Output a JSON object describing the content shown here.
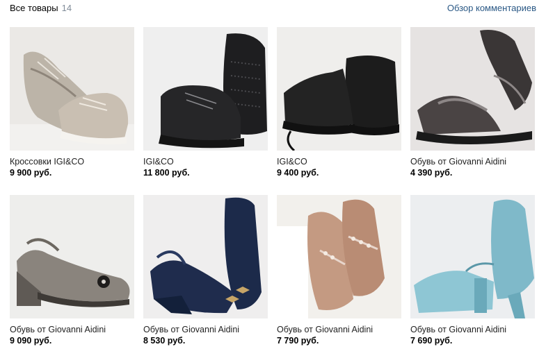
{
  "header": {
    "title": "Все товары",
    "count": "14",
    "link": "Обзор комментариев"
  },
  "products": [
    {
      "name": "Кроссовки IGI&CO",
      "price": "9 900 руб.",
      "image": "silver-sneakers-photo"
    },
    {
      "name": "IGI&CO",
      "price": "11 800 руб.",
      "image": "black-studded-sneakers-photo"
    },
    {
      "name": "IGI&CO",
      "price": "9 400 руб.",
      "image": "black-suede-ankle-boots-photo"
    },
    {
      "name": "Обувь от Giovanni Aidini",
      "price": "4 390 руб.",
      "image": "black-sandals-photo"
    },
    {
      "name": "Обувь от Giovanni Aidini",
      "price": "9 090 руб.",
      "image": "metallic-slingback-wedge-photo"
    },
    {
      "name": "Обувь от Giovanni Aidini",
      "price": "8 530 руб.",
      "image": "navy-slingback-wedge-photo"
    },
    {
      "name": "Обувь от Giovanni Aidini",
      "price": "7 790 руб.",
      "image": "beige-loafers-photo"
    },
    {
      "name": "Обувь от Giovanni Aidini",
      "price": "7 690 руб.",
      "image": "light-blue-slingback-heels-photo"
    }
  ]
}
